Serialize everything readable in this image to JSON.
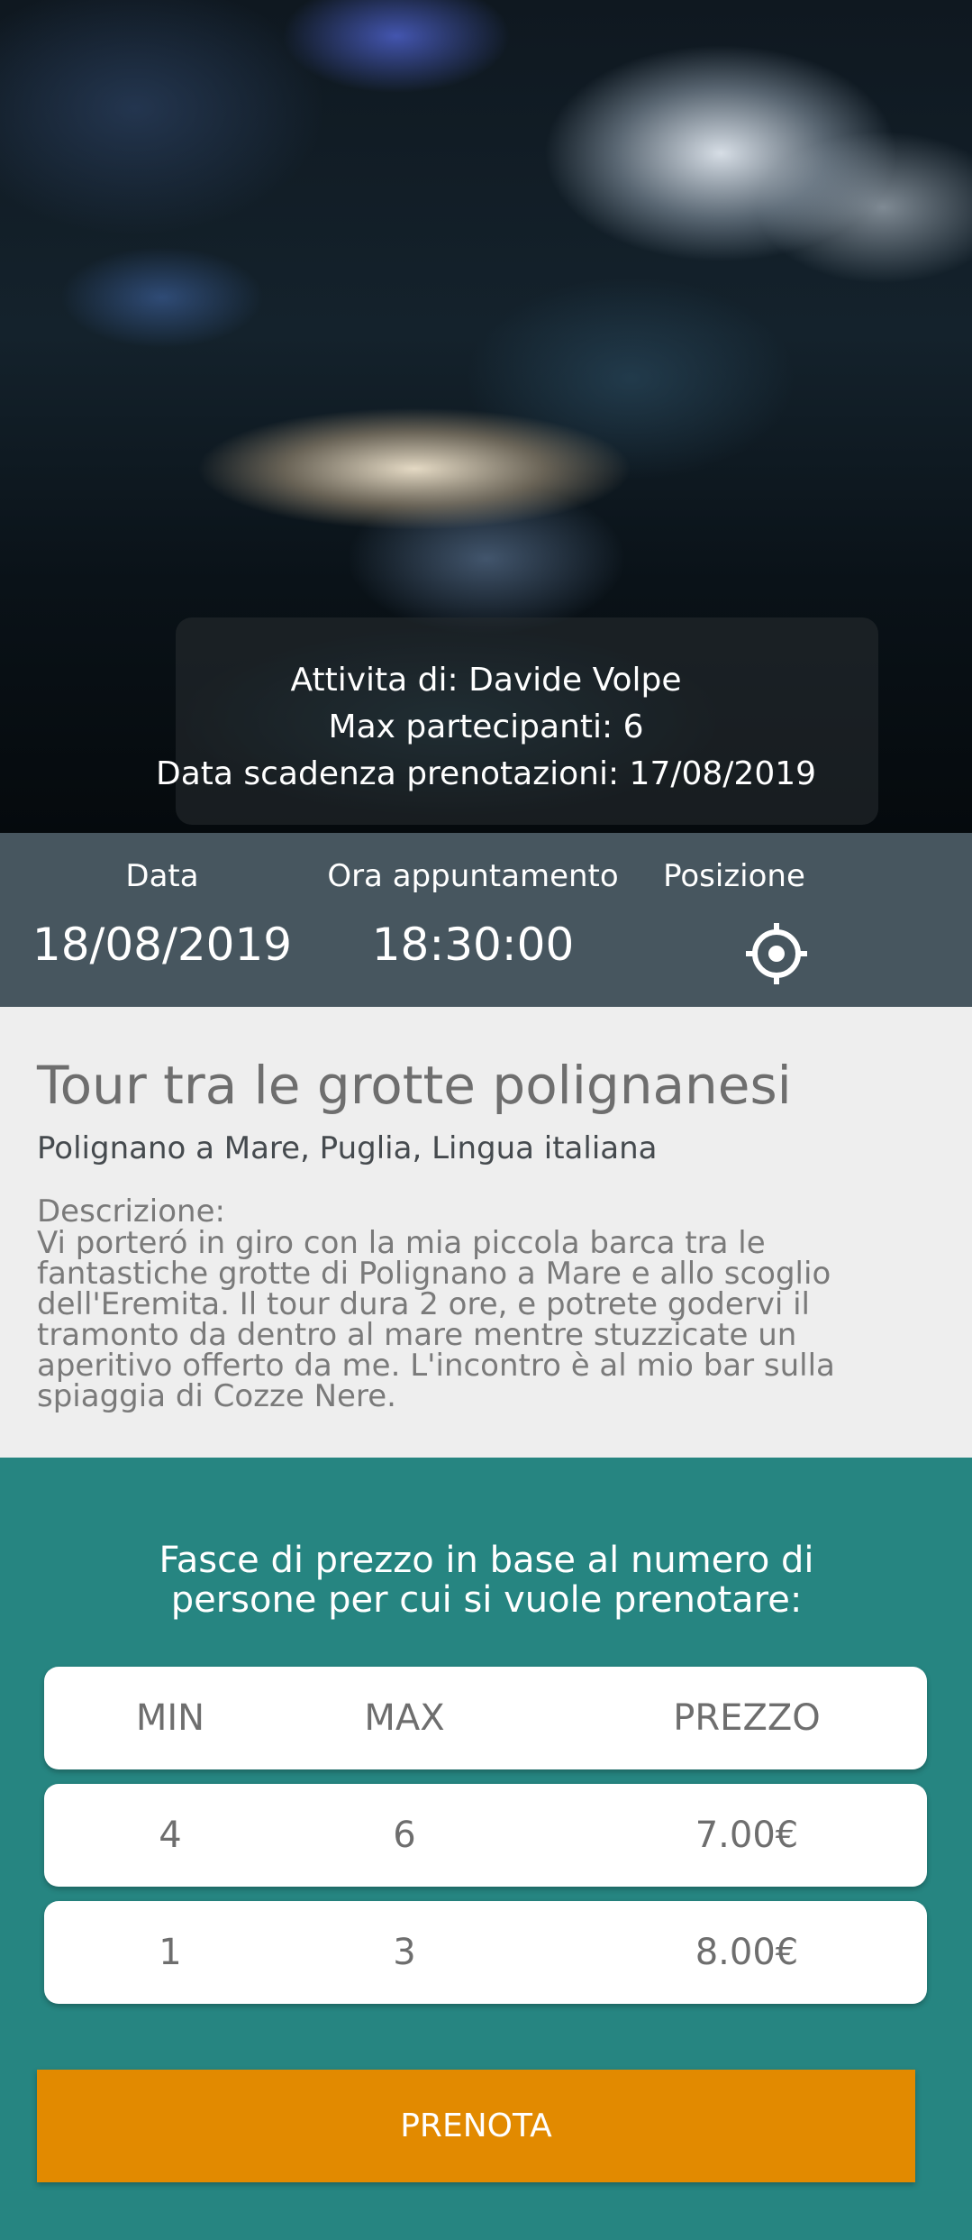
{
  "hero": {
    "image_alt": "cave-photo",
    "organizer": "Attivita di: Davide Volpe",
    "max_participants": "Max partecipanti: 6",
    "booking_deadline": "Data scadenza prenotazioni: 17/08/2019"
  },
  "info_bar": {
    "date_label": "Data",
    "date_value": "18/08/2019",
    "time_label": "Ora appuntamento",
    "time_value": "18:30:00",
    "position_label": "Posizione",
    "position_icon": "location-target-icon"
  },
  "details": {
    "title": "Tour tra le grotte polignanesi",
    "subtitle": "Polignano a Mare, Puglia, Lingua italiana",
    "description_label": "Descrizione:",
    "description": "Vi porteró in giro con la mia piccola barca tra le fantastiche grotte di Polignano a Mare e allo scoglio dell'Eremita. Il tour dura 2 ore, e potrete godervi il tramonto da dentro al mare mentre stuzzicate un aperitivo offerto da me. L'incontro è al mio bar sulla spiaggia di Cozze Nere."
  },
  "pricing": {
    "title": "Fasce di prezzo in base al numero di persone per cui si vuole prenotare:",
    "header": {
      "min": "MIN",
      "max": "MAX",
      "price": "PREZZO"
    },
    "rows": [
      {
        "min": "4",
        "max": "6",
        "price": "7.00€"
      },
      {
        "min": "1",
        "max": "3",
        "price": "8.00€"
      }
    ]
  },
  "actions": {
    "book_label": "PRENOTA"
  },
  "colors": {
    "info_bar": "#47565f",
    "pricing_bg": "#268581",
    "book_button": "#e28a00"
  }
}
